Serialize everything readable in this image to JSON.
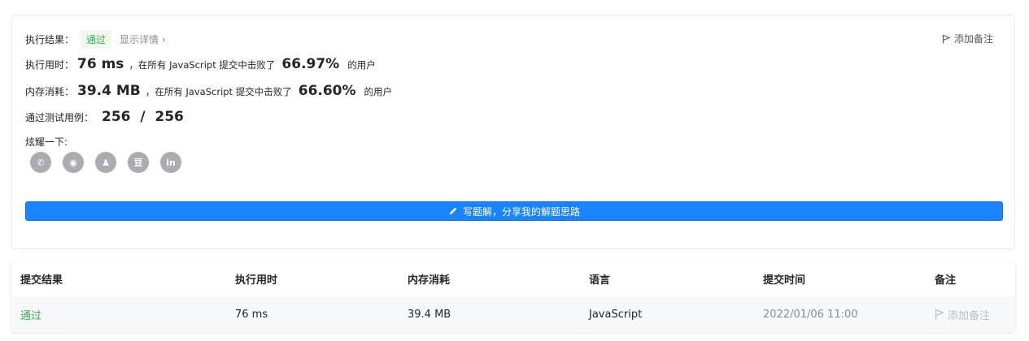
{
  "result": {
    "label": "执行结果：",
    "status": "通过",
    "detail_link": "显示详情 ›",
    "add_note": "添加备注"
  },
  "runtime": {
    "label": "执行用时：",
    "value": "76 ms",
    "text": "，在所有 JavaScript 提交中击败了",
    "percent": "66.97%",
    "suffix": "的用户"
  },
  "memory": {
    "label": "内存消耗：",
    "value": "39.4 MB",
    "text": "，在所有 JavaScript 提交中击败了",
    "percent": "66.60%",
    "suffix": "的用户"
  },
  "tests": {
    "label": "通过测试用例：",
    "value": "256  /  256"
  },
  "share": {
    "label": "炫耀一下:",
    "icons": [
      {
        "name": "wechat-icon",
        "glyph": "✆"
      },
      {
        "name": "weibo-icon",
        "glyph": "◉"
      },
      {
        "name": "qq-icon",
        "glyph": "♟"
      },
      {
        "name": "douban-icon",
        "glyph": "豆"
      },
      {
        "name": "linkedin-icon",
        "glyph": "in"
      }
    ]
  },
  "cta": {
    "label": "写题解，分享我的解题思路",
    "color": "#1a84ff"
  },
  "table": {
    "headers": [
      "提交结果",
      "执行用时",
      "内存消耗",
      "语言",
      "提交时间",
      "备注"
    ],
    "row": {
      "status": "通过",
      "runtime": "76 ms",
      "memory": "39.4 MB",
      "language": "JavaScript",
      "time": "2022/01/06 11:00",
      "note": "添加备注"
    }
  },
  "colors": {
    "success": "#2db55d",
    "primary": "#1a84ff",
    "muted": "#8c8c8c"
  }
}
